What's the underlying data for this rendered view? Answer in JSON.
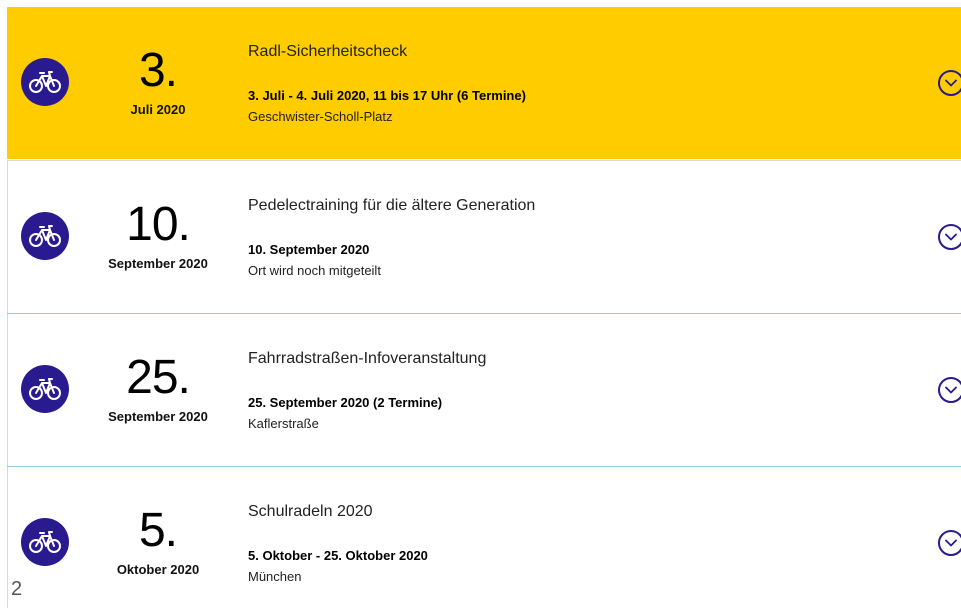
{
  "events": [
    {
      "day": "3.",
      "month_year": "Juli 2020",
      "title": "Radl-Sicherheitscheck",
      "date_line": "3. Juli - 4. Juli 2020, 11 bis 17 Uhr (6 Termine)",
      "place": "Geschwister-Scholl-Platz",
      "icon": "bicycle-icon",
      "highlighted": true
    },
    {
      "day": "10.",
      "month_year": "September 2020",
      "title": "Pedelectraining für die ältere Generation",
      "date_line": "10. September 2020",
      "place": "Ort wird noch mitgeteilt",
      "icon": "bicycle-icon",
      "highlighted": false
    },
    {
      "day": "25.",
      "month_year": "September 2020",
      "title": "Fahrradstraßen-Infoveranstaltung",
      "date_line": "25. September 2020 (2 Termine)",
      "place": "Kaflerstraße",
      "icon": "bicycle-icon",
      "highlighted": false
    },
    {
      "day": "5.",
      "month_year": "Oktober 2020",
      "title": "Schulradeln 2020",
      "date_line": "5. Oktober - 25. Oktober 2020",
      "place": "München",
      "icon": "bicycle-icon",
      "highlighted": false
    }
  ],
  "page_number": "2",
  "colors": {
    "highlight": "#ffcc00",
    "accent": "#2a1a8f",
    "separator": "#8fcfdc"
  }
}
